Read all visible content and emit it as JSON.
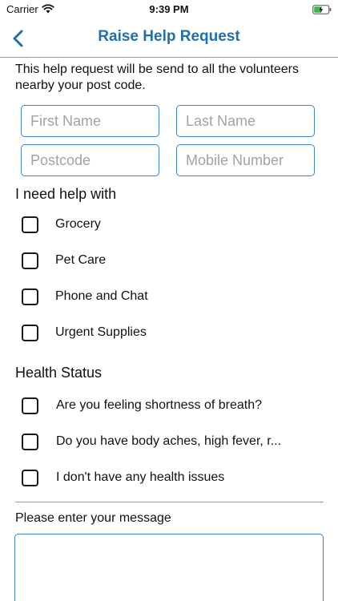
{
  "status_bar": {
    "carrier": "Carrier",
    "time": "9:39 PM",
    "battery_color": "#3bb54a"
  },
  "nav": {
    "title": "Raise Help Request",
    "back_icon": "chevron-left-icon",
    "accent_color": "#1f6fb2"
  },
  "intro": "This help request will be send to all the volunteers nearby your post code.",
  "form": {
    "first_name_placeholder": "First Name",
    "last_name_placeholder": "Last Name",
    "postcode_placeholder": "Postcode",
    "mobile_placeholder": "Mobile Number"
  },
  "help_section": {
    "heading": "I need help with",
    "options": [
      {
        "label": "Grocery",
        "checked": false
      },
      {
        "label": "Pet Care",
        "checked": false
      },
      {
        "label": "Phone and Chat",
        "checked": false
      },
      {
        "label": "Urgent Supplies",
        "checked": false
      }
    ]
  },
  "health_section": {
    "heading": "Health Status",
    "options": [
      {
        "label": "Are you feeling shortness of breath?",
        "checked": false
      },
      {
        "label": "Do you have body aches, high fever, r...",
        "checked": false
      },
      {
        "label": "I don't have any health issues",
        "checked": false
      }
    ]
  },
  "message": {
    "label": "Please enter your message",
    "value": ""
  }
}
